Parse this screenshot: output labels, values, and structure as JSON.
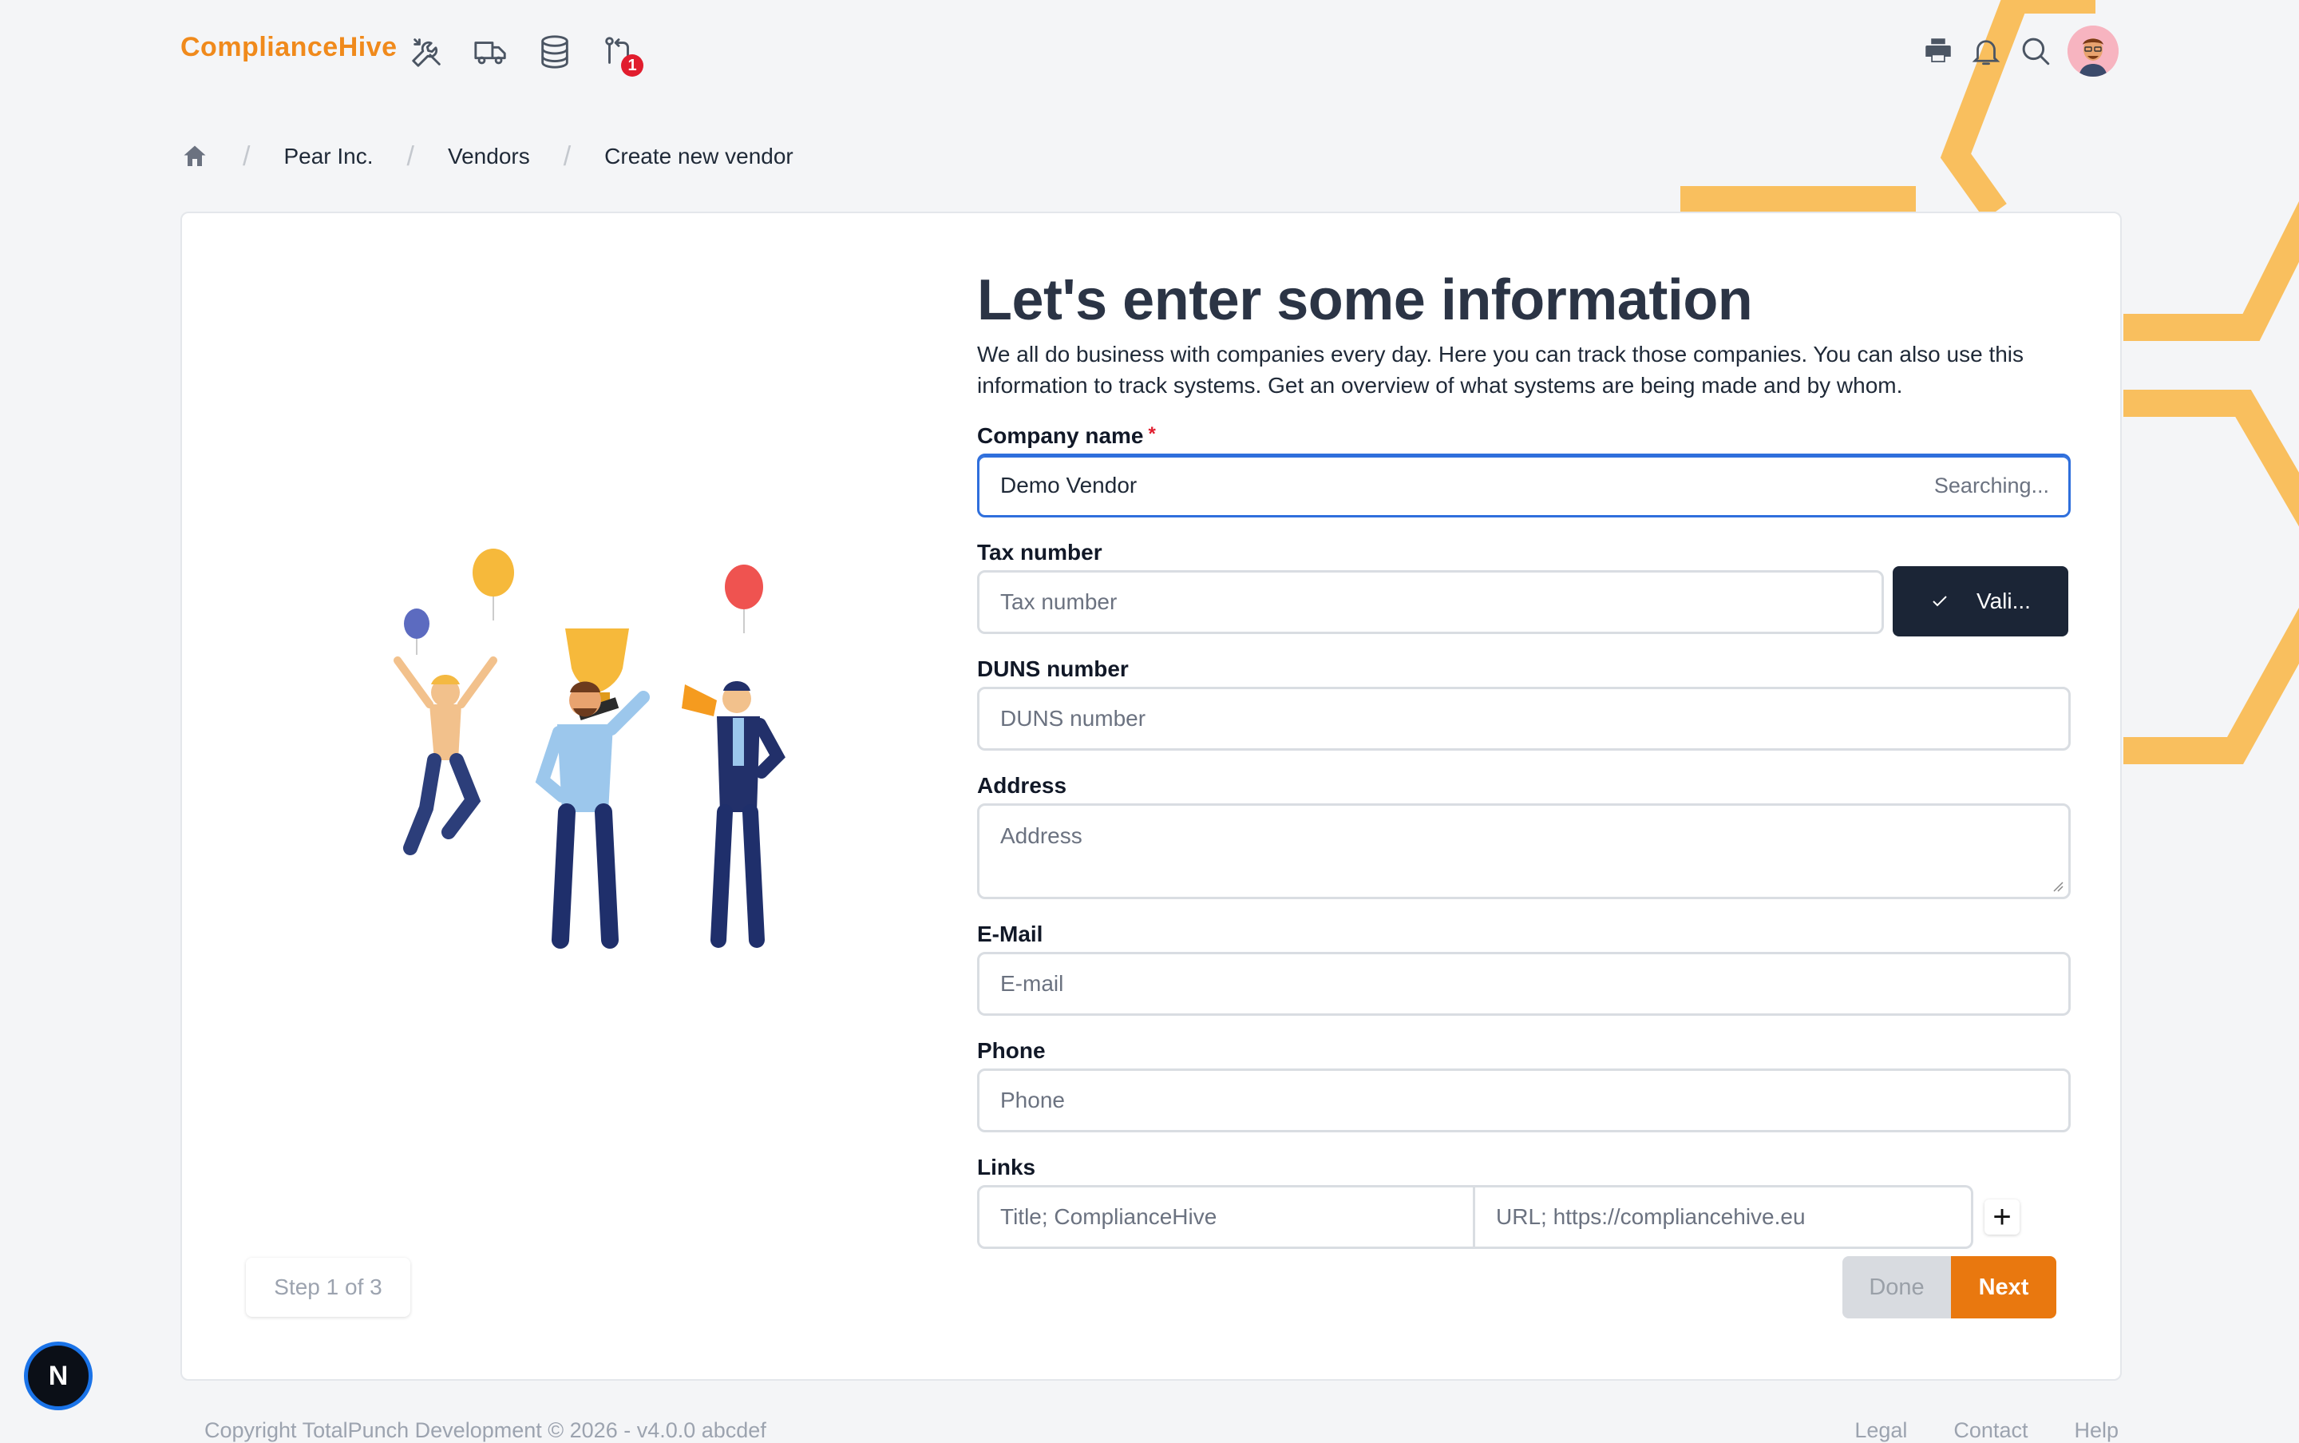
{
  "app": {
    "logo_text": "ComplianceHive",
    "notification_count": "1"
  },
  "breadcrumb": {
    "items": [
      "Pear Inc.",
      "Vendors",
      "Create new vendor"
    ]
  },
  "page": {
    "title": "Let's enter some information",
    "description": "We all do business with companies every day. Here you can track those companies. You can also use this information to track systems. Get an overview of what systems are being made and by whom."
  },
  "form": {
    "company_name": {
      "label": "Company name",
      "required_mark": "*",
      "value": "Demo Vendor",
      "hint": "Searching..."
    },
    "tax_number": {
      "label": "Tax number",
      "placeholder": "Tax number",
      "validate_label": "Vali..."
    },
    "duns_number": {
      "label": "DUNS number",
      "placeholder": "DUNS number"
    },
    "address": {
      "label": "Address",
      "placeholder": "Address"
    },
    "email": {
      "label": "E-Mail",
      "placeholder": "E-mail"
    },
    "phone": {
      "label": "Phone",
      "placeholder": "Phone"
    },
    "links": {
      "label": "Links",
      "title_placeholder": "Title; ComplianceHive",
      "url_placeholder": "URL; https://compliancehive.eu",
      "add_label": "+"
    }
  },
  "wizard": {
    "step_text": "Step 1 of 3",
    "done_label": "Done",
    "next_label": "Next"
  },
  "footer": {
    "copyright": "Copyright TotalPunch Development © 2026 - v4.0.0 abcdef",
    "links": [
      "Legal",
      "Contact",
      "Help"
    ]
  },
  "dev_badge": {
    "label": "N"
  },
  "colors": {
    "accent": "#e9780f",
    "hex_pattern": "#f9bf5e",
    "dark_button": "#1b2536",
    "focus": "#2f6fdc"
  }
}
